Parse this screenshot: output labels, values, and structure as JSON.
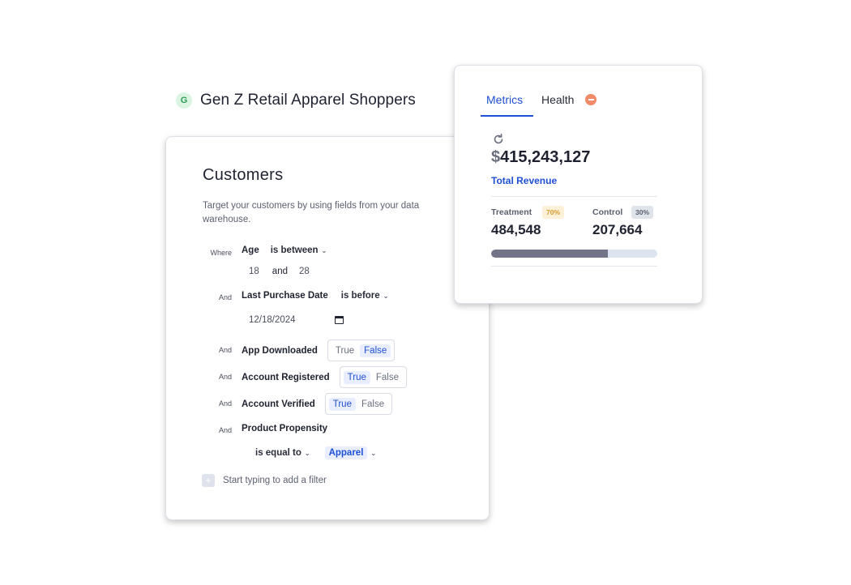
{
  "audience": {
    "avatar_letter": "G",
    "title": "Gen Z Retail Apparel Shoppers"
  },
  "customers": {
    "title": "Customers",
    "description": "Target your customers by using fields from your data warehouse.",
    "filters": {
      "age": {
        "conj": "Where",
        "field": "Age",
        "operator": "is between",
        "min": "18",
        "and_label": "and",
        "max": "28"
      },
      "last_purchase": {
        "conj": "And",
        "field": "Last Purchase Date",
        "operator": "is before",
        "date": "12/18/2024"
      },
      "app_downloaded": {
        "conj": "And",
        "field": "App Downloaded",
        "true_label": "True",
        "false_label": "False",
        "selected": "False"
      },
      "account_registered": {
        "conj": "And",
        "field": "Account Registered",
        "true_label": "True",
        "false_label": "False",
        "selected": "True"
      },
      "account_verified": {
        "conj": "And",
        "field": "Account Verified",
        "true_label": "True",
        "false_label": "False",
        "selected": "True"
      },
      "product_propensity": {
        "conj": "And",
        "field": "Product Propensity",
        "operator": "is equal to",
        "value": "Apparel"
      }
    },
    "add_filter": {
      "icon": "plus-icon",
      "text": "Start typing to add a filter"
    }
  },
  "metrics": {
    "tabs": {
      "metrics": "Metrics",
      "health": "Health"
    },
    "revenue": {
      "currency": "$",
      "amount": "415,243,127",
      "label": "Total Revenue"
    },
    "treatment": {
      "label": "Treatment",
      "badge": "70%",
      "value": "484,548"
    },
    "control": {
      "label": "Control",
      "badge": "30%",
      "value": "207,664"
    },
    "split_fraction": 0.7,
    "colors": {
      "accent": "#1f4fd6",
      "bar": "#737487",
      "health": "#f08a68"
    }
  }
}
